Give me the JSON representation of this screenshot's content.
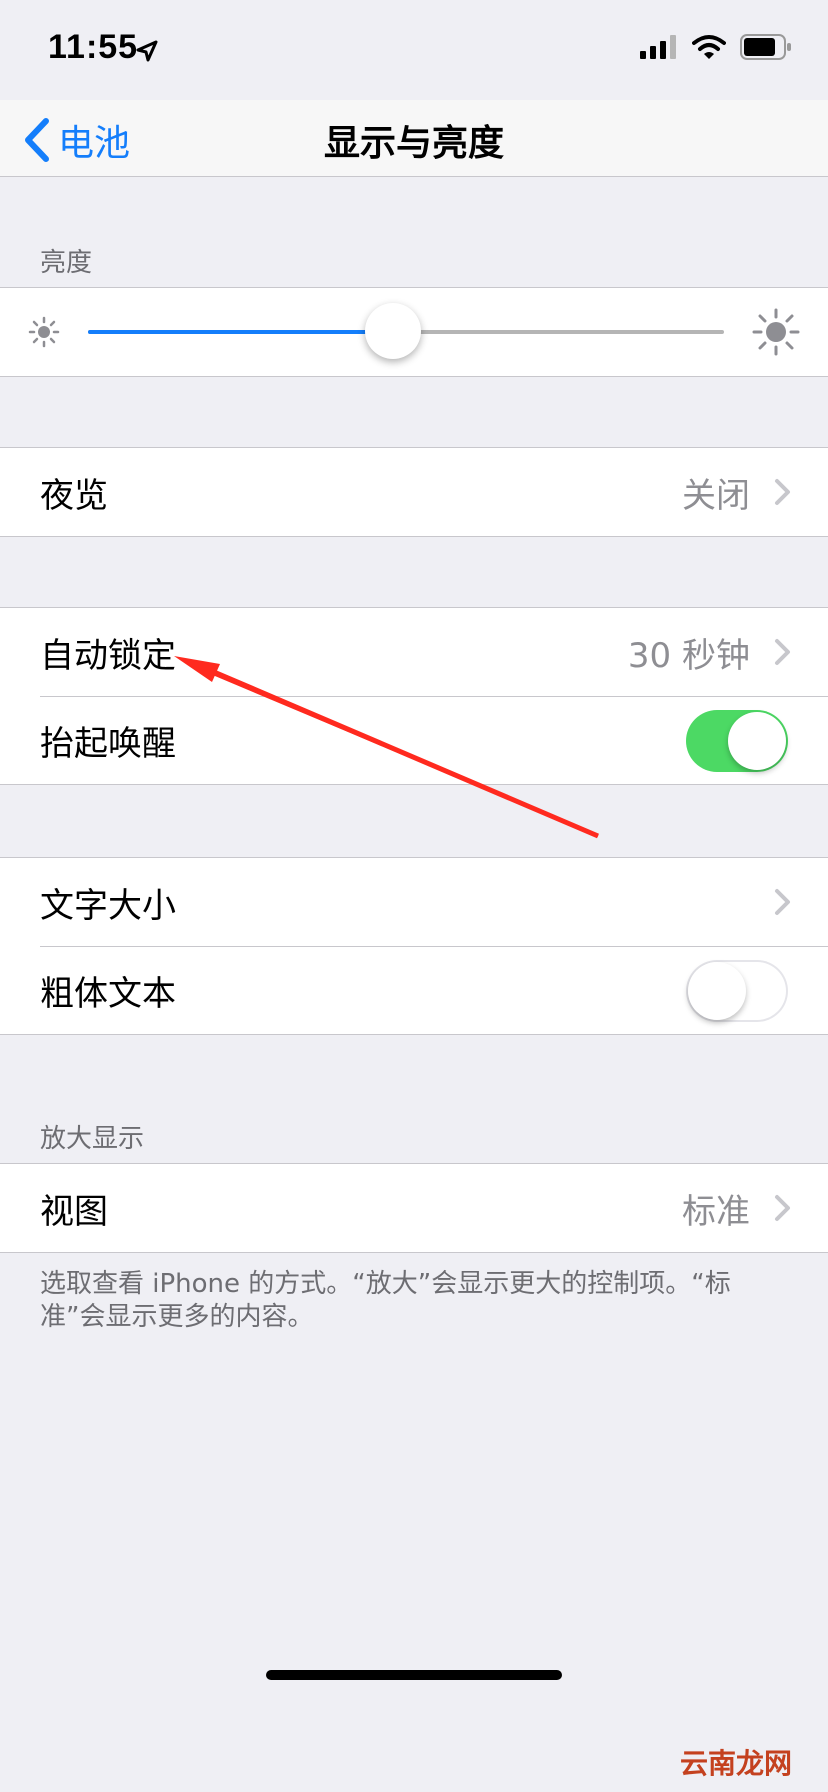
{
  "status": {
    "time": "11:55"
  },
  "nav": {
    "back_label": "电池",
    "title": "显示与亮度"
  },
  "brightness": {
    "header": "亮度",
    "level": 0.48
  },
  "night_shift": {
    "label": "夜览",
    "value": "关闭"
  },
  "auto_lock": {
    "label": "自动锁定",
    "value": "30 秒钟"
  },
  "raise_to_wake": {
    "label": "抬起唤醒",
    "on": true
  },
  "text_size": {
    "label": "文字大小"
  },
  "bold_text": {
    "label": "粗体文本",
    "on": false
  },
  "display_zoom": {
    "header": "放大显示",
    "view_label": "视图",
    "view_value": "标准",
    "footer": "选取查看 iPhone 的方式。“放大”会显示更大的控制项。“标准”会显示更多的内容。"
  },
  "watermark": "云南龙网",
  "colors": {
    "accent": "#147efb",
    "switch_on": "#4cd964",
    "annotation": "#ff2a1f"
  }
}
